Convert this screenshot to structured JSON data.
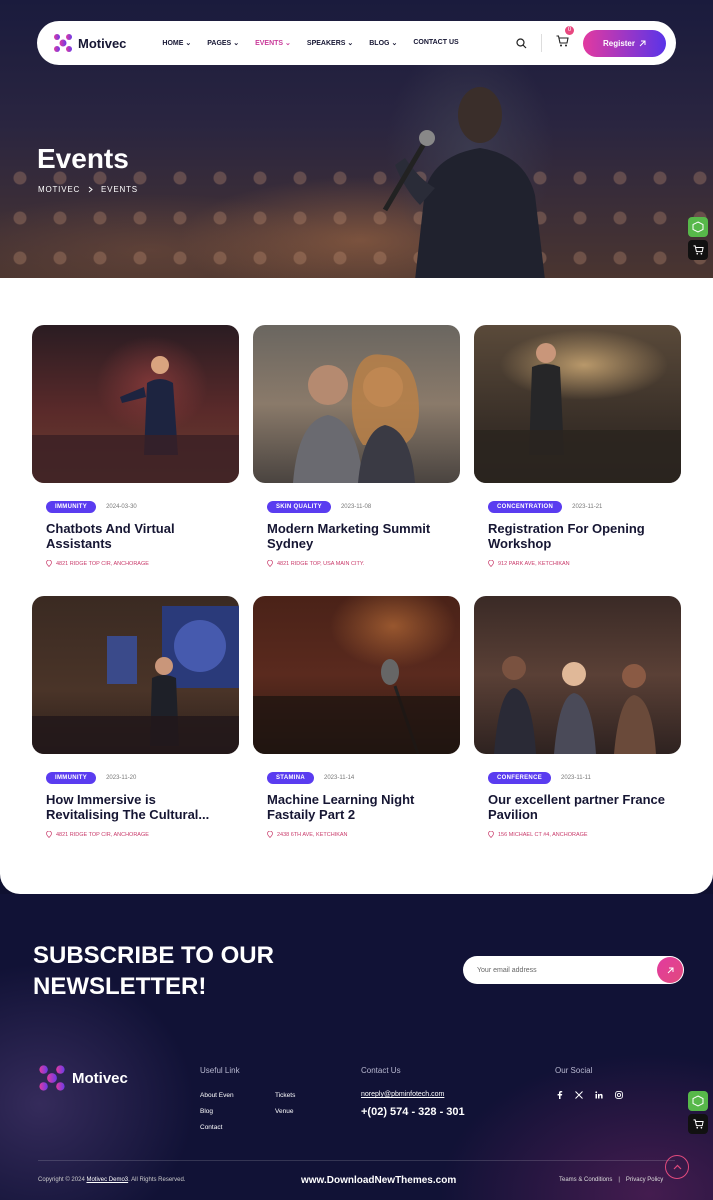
{
  "nav": {
    "brand": "Motivec",
    "menu": [
      {
        "label": "HOME",
        "dropdown": true
      },
      {
        "label": "PAGES",
        "dropdown": true
      },
      {
        "label": "EVENTS",
        "dropdown": true,
        "active": true
      },
      {
        "label": "SPEAKERS",
        "dropdown": true
      },
      {
        "label": "BLOG",
        "dropdown": true
      },
      {
        "label": "CONTACT US",
        "dropdown": false
      }
    ],
    "cart_count": "0",
    "register_label": "Register"
  },
  "hero": {
    "title": "Events",
    "breadcrumb": [
      "MOTIVEC",
      "EVENTS"
    ]
  },
  "events": [
    {
      "tag": "IMMUNITY",
      "date": "2024-03-30",
      "title_lines": [
        "Chatbots And Virtual",
        "Assistants"
      ],
      "location": "4821 RIDGE TOP CIR, ANCHORAGE"
    },
    {
      "tag": "SKIN QUALITY",
      "date": "2023-11-08",
      "title_lines": [
        "Modern Marketing Summit",
        "Sydney"
      ],
      "location": "4821 RIDGE TOP, USA MAIN CITY."
    },
    {
      "tag": "CONCENTRATION",
      "date": "2023-11-21",
      "title_lines": [
        "Registration For Opening",
        "Workshop"
      ],
      "location": "912 PARK AVE, KETCHIKAN"
    },
    {
      "tag": "IMMUNITY",
      "date": "2023-11-20",
      "title_lines": [
        "How Immersive is",
        "Revitalising The Cultural..."
      ],
      "location": "4821 RIDGE TOP CIR, ANCHORAGE"
    },
    {
      "tag": "STAMINA",
      "date": "2023-11-14",
      "title_lines": [
        "Machine Learning Night",
        "Fastaily Part 2"
      ],
      "location": "2438 6TH AVE, KETCHIKAN"
    },
    {
      "tag": "CONFERENCE",
      "date": "2023-11-11",
      "title_lines": [
        "Our excellent partner France",
        "Pavilion"
      ],
      "location": "156 MICHAEL CT #4, ANCHORAGE"
    }
  ],
  "newsletter": {
    "title_lines": [
      "SUBSCRIBE TO OUR",
      "NEWSLETTER!"
    ],
    "placeholder": "Your email address"
  },
  "footer": {
    "brand": "Motivec",
    "useful_link": {
      "heading": "Useful Link",
      "col1": [
        "About Even",
        "Blog",
        "Contact"
      ],
      "col2": [
        "Tickets",
        "Venue"
      ]
    },
    "contact": {
      "heading": "Contact Us",
      "email": "noreply@pbminfotech.com",
      "phone": "+(02) 574 - 328 - 301"
    },
    "social": {
      "heading": "Our Social",
      "icons": [
        "facebook-icon",
        "x-icon",
        "linkedin-icon",
        "instagram-icon"
      ]
    },
    "copyright_prefix": "Copyright © 2024",
    "copyright_link": "Motivec Demo3",
    "copyright_suffix": ". All Rights Reserved.",
    "watermark": "www.DownloadNewThemes.com",
    "legal": [
      "Teams & Conditions",
      "|",
      "Privacy Policy"
    ]
  },
  "colors": {
    "accent": "#5a3cf0",
    "pink": "#e23aa0",
    "dark": "#111236"
  }
}
